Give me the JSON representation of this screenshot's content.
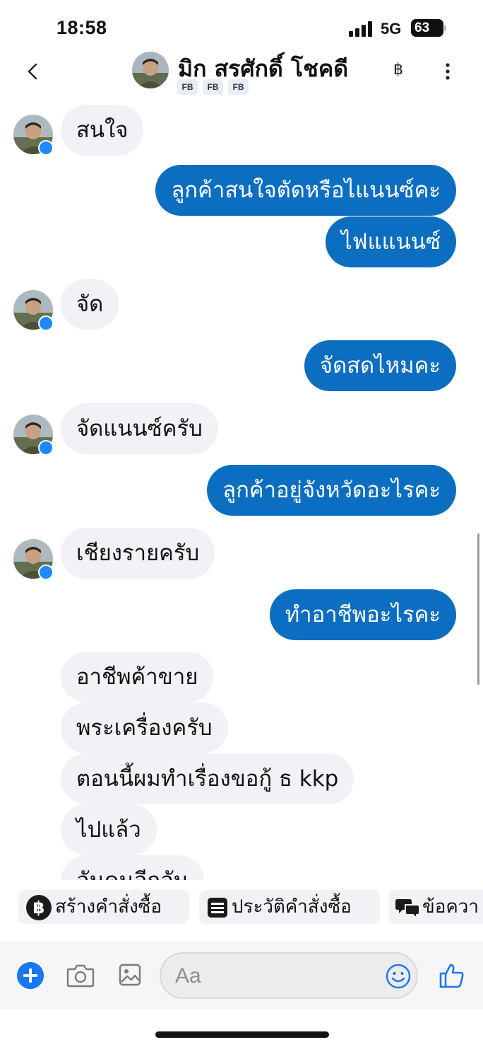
{
  "status_bar": {
    "time": "18:58",
    "network": "5G",
    "battery": "63"
  },
  "header": {
    "name": "มิก สรศักดิ์ โชคดี",
    "tags": [
      "FB",
      "FB",
      "FB"
    ],
    "currency_symbol": "฿"
  },
  "messages": [
    {
      "dir": "in",
      "text": "สนใจ"
    },
    {
      "dir": "out",
      "text": "ลูกค้าสนใจตัดหรือไแนนซ์คะ"
    },
    {
      "dir": "out",
      "text": "ไฟแแนนซ์"
    },
    {
      "dir": "in",
      "text": "จัด"
    },
    {
      "dir": "out",
      "text": "จัดสดไหมคะ"
    },
    {
      "dir": "in",
      "text": "จัดแนนซ์ครับ"
    },
    {
      "dir": "out",
      "text": "ลูกค้าอยู่จังหวัดอะไรคะ"
    },
    {
      "dir": "in",
      "text": "เชียงรายครับ"
    },
    {
      "dir": "out",
      "text": "ทำอาชีพอะไรคะ"
    },
    {
      "dir": "in",
      "text": "อาชีพค้าขาย"
    },
    {
      "dir": "in",
      "text": "พระเครื่องครับ"
    },
    {
      "dir": "in",
      "text": "ตอนนี้ผมทำเรื่องขอกู้ ธ kkp"
    },
    {
      "dir": "in",
      "text": "ไปแล้ว"
    },
    {
      "dir": "in",
      "text": "อันคนอีกอัน"
    }
  ],
  "quick_actions": [
    {
      "label": "สร้างคำสั่งซื้อ",
      "icon": "baht-circle-icon"
    },
    {
      "label": "ประวัติคำสั่งซื้อ",
      "icon": "list-icon"
    },
    {
      "label": "ข้อควา",
      "icon": "chat-bubbles-icon"
    }
  ],
  "composer": {
    "placeholder": "Aa"
  },
  "colors": {
    "outgoing_bubble": "#0b6ec1",
    "incoming_bubble": "#f1f2f6",
    "accent": "#1877f2"
  }
}
